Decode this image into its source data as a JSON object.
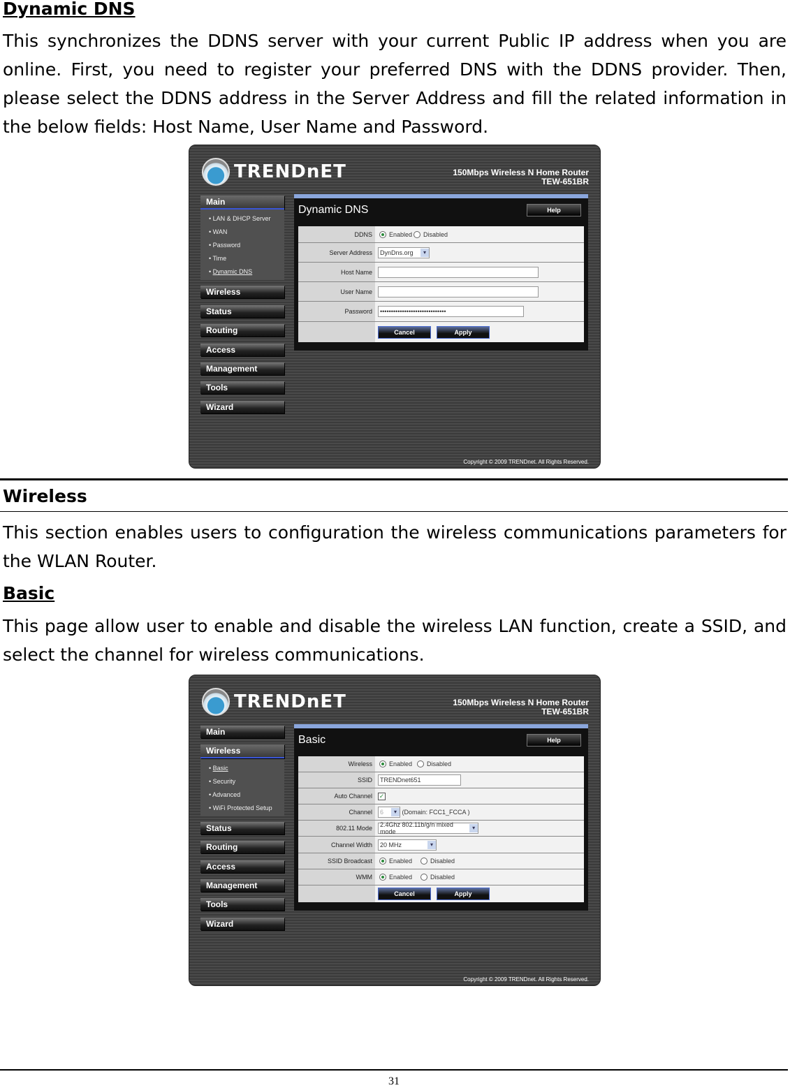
{
  "section1": {
    "heading": "Dynamic DNS",
    "paragraph": "This synchronizes the DDNS server with your current Public IP address when you are online.  First, you need to register your preferred DNS with the DDNS provider. Then, please select the DDNS address in the Server Address and fill the related information in the below fields: Host Name, User Name and Password."
  },
  "section2": {
    "heading": "Wireless",
    "paragraph": "This section enables users to configuration the wireless communications parameters for the WLAN Router."
  },
  "section3": {
    "heading": "Basic",
    "paragraph": "This page allow user to enable and disable the wireless LAN function, create a SSID, and select the channel for wireless communications."
  },
  "router": {
    "logo": "TRENDnET",
    "product_line1": "150Mbps Wireless N Home Router",
    "product_line2": "TEW-651BR",
    "copyright": "Copyright © 2009 TRENDnet. All Rights Reserved.",
    "help_label": "Help",
    "cancel_label": "Cancel",
    "apply_label": "Apply",
    "enabled_label": "Enabled",
    "disabled_label": "Disabled"
  },
  "shot1": {
    "nav": [
      "Main",
      "Wireless",
      "Status",
      "Routing",
      "Access",
      "Management",
      "Tools",
      "Wizard"
    ],
    "submenu": [
      "LAN & DHCP Server",
      "WAN",
      "Password",
      "Time",
      "Dynamic DNS"
    ],
    "title": "Dynamic DNS",
    "labels": {
      "ddns": "DDNS",
      "server": "Server Address",
      "host": "Host Name",
      "user": "User Name",
      "password": "Password"
    },
    "server_value": "DynDns.org",
    "host_value": "",
    "user_value": "",
    "password_value": "••••••••••••••••••••••••••••••"
  },
  "shot2": {
    "nav": [
      "Main",
      "Wireless",
      "Status",
      "Routing",
      "Access",
      "Management",
      "Tools",
      "Wizard"
    ],
    "submenu": [
      "Basic",
      "Security",
      "Advanced",
      "WiFi Protected Setup"
    ],
    "title": "Basic",
    "labels": {
      "wireless": "Wireless",
      "ssid": "SSID",
      "auto": "Auto Channel",
      "channel": "Channel",
      "mode": "802.11 Mode",
      "width": "Channel Width",
      "broadcast": "SSID Broadcast",
      "wmm": "WMM"
    },
    "ssid_value": "TRENDnet651",
    "channel_value": "6",
    "domain_text": "(Domain: FCC1_FCCA )",
    "mode_value": "2.4Ghz 802.11b/g/n mixed mode",
    "width_value": "20 MHz"
  },
  "page_number": "31"
}
